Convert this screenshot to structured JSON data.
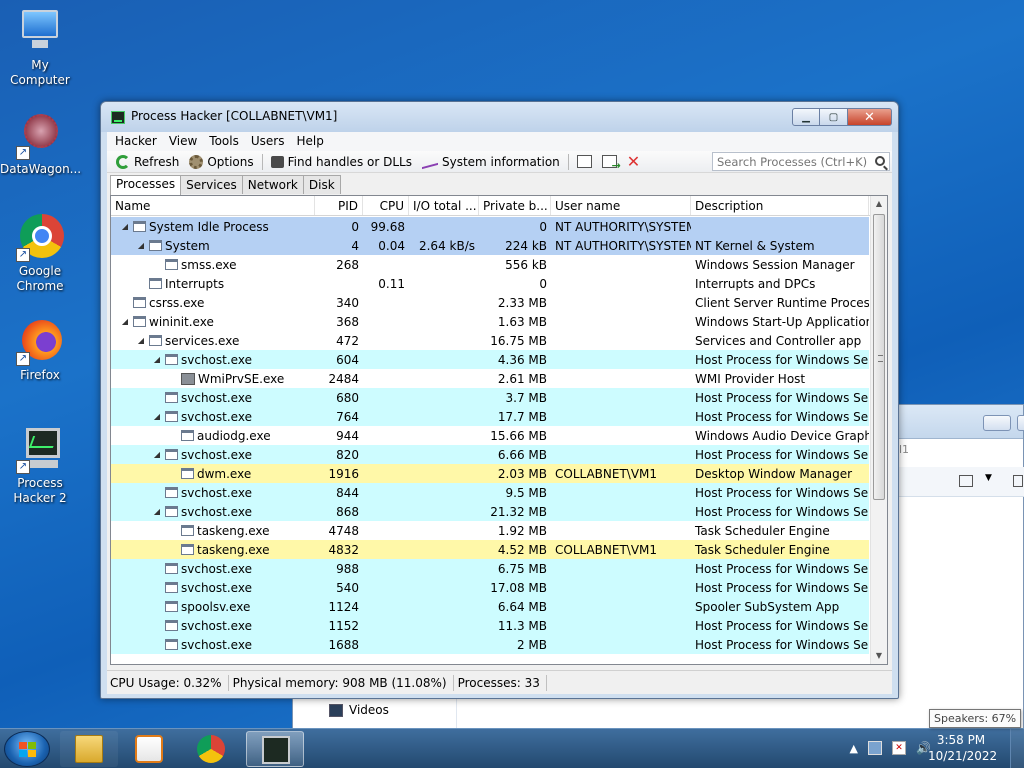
{
  "desktop": {
    "icons": [
      {
        "label": "My Computer"
      },
      {
        "label": "DataWagon..."
      },
      {
        "label": "Google Chrome"
      },
      {
        "label": "Firefox"
      },
      {
        "label": "Process Hacker 2"
      }
    ]
  },
  "background_window": {
    "crumb": "l1",
    "sidebar_item": "Videos"
  },
  "window": {
    "title": "Process Hacker [COLLABNET\\VM1]",
    "menu": [
      "Hacker",
      "View",
      "Tools",
      "Users",
      "Help"
    ],
    "toolbar": {
      "refresh": "Refresh",
      "options": "Options",
      "find_handles": "Find handles or DLLs",
      "system_info": "System information",
      "search_placeholder": "Search Processes (Ctrl+K)"
    },
    "tabs": [
      "Processes",
      "Services",
      "Network",
      "Disk"
    ],
    "active_tab": "Processes",
    "columns": {
      "name": "Name",
      "pid": "PID",
      "cpu": "CPU",
      "io": "I/O total ...",
      "private": "Private b...",
      "user": "User name",
      "desc": "Description"
    },
    "rows": [
      {
        "indent": 0,
        "exp": "◢",
        "name": "System Idle Process",
        "pid": "0",
        "cpu": "99.68",
        "io": "",
        "priv": "0",
        "user": "NT AUTHORITY\\SYSTEM",
        "desc": "",
        "kind": "sys"
      },
      {
        "indent": 1,
        "exp": "◢",
        "name": "System",
        "pid": "4",
        "cpu": "0.04",
        "io": "2.64 kB/s",
        "priv": "224 kB",
        "user": "NT AUTHORITY\\SYSTEM",
        "desc": "NT Kernel & System",
        "kind": "sys"
      },
      {
        "indent": 2,
        "exp": "",
        "name": "smss.exe",
        "pid": "268",
        "cpu": "",
        "io": "",
        "priv": "556 kB",
        "user": "",
        "desc": "Windows Session Manager",
        "kind": "plain"
      },
      {
        "indent": 1,
        "exp": "",
        "name": "Interrupts",
        "pid": "",
        "cpu": "0.11",
        "io": "",
        "priv": "0",
        "user": "",
        "desc": "Interrupts and DPCs",
        "kind": "plain"
      },
      {
        "indent": 0,
        "exp": "",
        "name": "csrss.exe",
        "pid": "340",
        "cpu": "",
        "io": "",
        "priv": "2.33 MB",
        "user": "",
        "desc": "Client Server Runtime Process",
        "kind": "plain"
      },
      {
        "indent": 0,
        "exp": "◢",
        "name": "wininit.exe",
        "pid": "368",
        "cpu": "",
        "io": "",
        "priv": "1.63 MB",
        "user": "",
        "desc": "Windows Start-Up Application",
        "kind": "plain"
      },
      {
        "indent": 1,
        "exp": "◢",
        "name": "services.exe",
        "pid": "472",
        "cpu": "",
        "io": "",
        "priv": "16.75 MB",
        "user": "",
        "desc": "Services and Controller app",
        "kind": "plain"
      },
      {
        "indent": 2,
        "exp": "◢",
        "name": "svchost.exe",
        "pid": "604",
        "cpu": "",
        "io": "",
        "priv": "4.36 MB",
        "user": "",
        "desc": "Host Process for Windows Ser...",
        "kind": "svc"
      },
      {
        "indent": 3,
        "exp": "",
        "name": "WmiPrvSE.exe",
        "pid": "2484",
        "cpu": "",
        "io": "",
        "priv": "2.61 MB",
        "user": "",
        "desc": "WMI Provider Host",
        "kind": "plain",
        "wmi": true
      },
      {
        "indent": 2,
        "exp": "",
        "name": "svchost.exe",
        "pid": "680",
        "cpu": "",
        "io": "",
        "priv": "3.7 MB",
        "user": "",
        "desc": "Host Process for Windows Ser...",
        "kind": "svc"
      },
      {
        "indent": 2,
        "exp": "◢",
        "name": "svchost.exe",
        "pid": "764",
        "cpu": "",
        "io": "",
        "priv": "17.7 MB",
        "user": "",
        "desc": "Host Process for Windows Ser...",
        "kind": "svc"
      },
      {
        "indent": 3,
        "exp": "",
        "name": "audiodg.exe",
        "pid": "944",
        "cpu": "",
        "io": "",
        "priv": "15.66 MB",
        "user": "",
        "desc": "Windows Audio Device Graph...",
        "kind": "plain"
      },
      {
        "indent": 2,
        "exp": "◢",
        "name": "svchost.exe",
        "pid": "820",
        "cpu": "",
        "io": "",
        "priv": "6.66 MB",
        "user": "",
        "desc": "Host Process for Windows Ser...",
        "kind": "svc"
      },
      {
        "indent": 3,
        "exp": "",
        "name": "dwm.exe",
        "pid": "1916",
        "cpu": "",
        "io": "",
        "priv": "2.03 MB",
        "user": "COLLABNET\\VM1",
        "desc": "Desktop Window Manager",
        "kind": "own"
      },
      {
        "indent": 2,
        "exp": "",
        "name": "svchost.exe",
        "pid": "844",
        "cpu": "",
        "io": "",
        "priv": "9.5 MB",
        "user": "",
        "desc": "Host Process for Windows Ser...",
        "kind": "svc"
      },
      {
        "indent": 2,
        "exp": "◢",
        "name": "svchost.exe",
        "pid": "868",
        "cpu": "",
        "io": "",
        "priv": "21.32 MB",
        "user": "",
        "desc": "Host Process for Windows Ser...",
        "kind": "svc"
      },
      {
        "indent": 3,
        "exp": "",
        "name": "taskeng.exe",
        "pid": "4748",
        "cpu": "",
        "io": "",
        "priv": "1.92 MB",
        "user": "",
        "desc": "Task Scheduler Engine",
        "kind": "plain"
      },
      {
        "indent": 3,
        "exp": "",
        "name": "taskeng.exe",
        "pid": "4832",
        "cpu": "",
        "io": "",
        "priv": "4.52 MB",
        "user": "COLLABNET\\VM1",
        "desc": "Task Scheduler Engine",
        "kind": "own"
      },
      {
        "indent": 2,
        "exp": "",
        "name": "svchost.exe",
        "pid": "988",
        "cpu": "",
        "io": "",
        "priv": "6.75 MB",
        "user": "",
        "desc": "Host Process for Windows Ser...",
        "kind": "svc"
      },
      {
        "indent": 2,
        "exp": "",
        "name": "svchost.exe",
        "pid": "540",
        "cpu": "",
        "io": "",
        "priv": "17.08 MB",
        "user": "",
        "desc": "Host Process for Windows Ser...",
        "kind": "svc"
      },
      {
        "indent": 2,
        "exp": "",
        "name": "spoolsv.exe",
        "pid": "1124",
        "cpu": "",
        "io": "",
        "priv": "6.64 MB",
        "user": "",
        "desc": "Spooler SubSystem App",
        "kind": "svc"
      },
      {
        "indent": 2,
        "exp": "",
        "name": "svchost.exe",
        "pid": "1152",
        "cpu": "",
        "io": "",
        "priv": "11.3 MB",
        "user": "",
        "desc": "Host Process for Windows Ser...",
        "kind": "svc"
      },
      {
        "indent": 2,
        "exp": "",
        "name": "svchost.exe",
        "pid": "1688",
        "cpu": "",
        "io": "",
        "priv": "2 MB",
        "user": "",
        "desc": "Host Process for Windows Ser...",
        "kind": "svc"
      }
    ],
    "status": {
      "cpu": "CPU Usage: 0.32%",
      "memory": "Physical memory: 908 MB (11.08%)",
      "processes": "Processes: 33"
    }
  },
  "taskbar": {
    "time": "3:58 PM",
    "date": "10/21/2022",
    "tooltip": "Speakers: 67%"
  },
  "colors": {
    "system_row": "#b5d0f3",
    "service_row": "#cdfcff",
    "own_process_row": "#fff8a8"
  }
}
